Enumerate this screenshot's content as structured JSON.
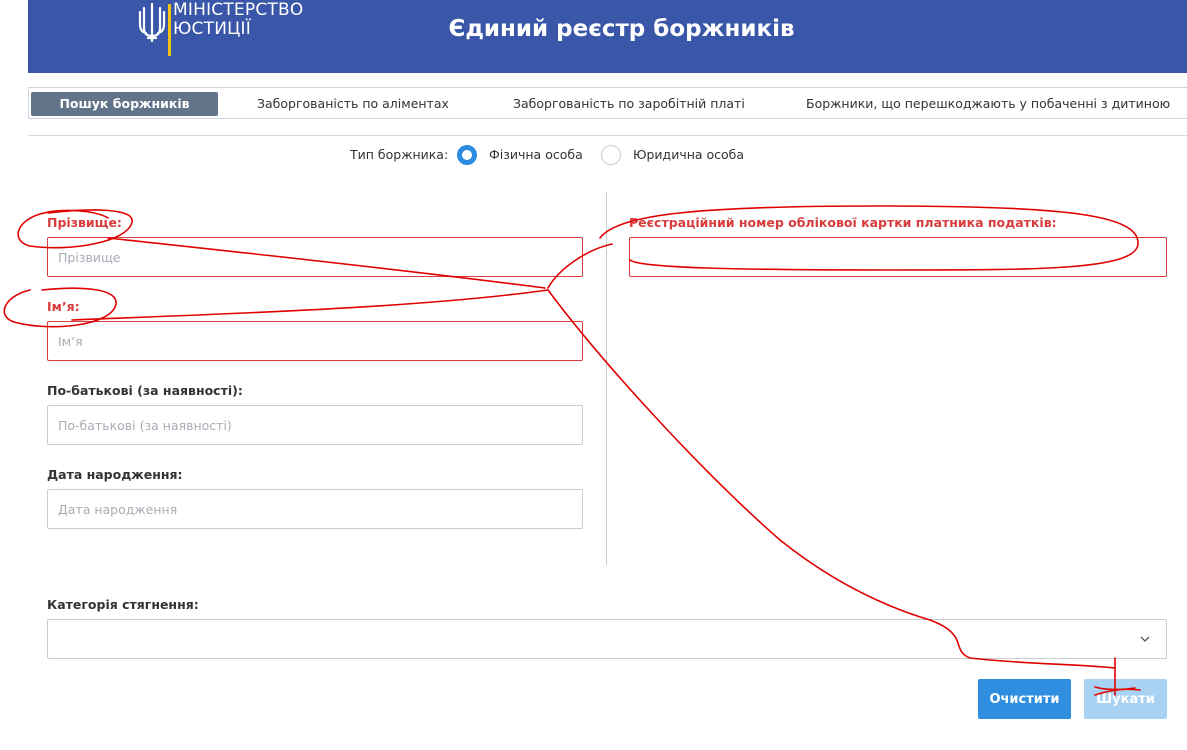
{
  "header": {
    "logo_line1": "МІНІСТЕРСТВО",
    "logo_line2": "ЮСТИЦІЇ",
    "title": "Єдиний реєстр боржників"
  },
  "tabs": [
    {
      "label": "Пошук боржників",
      "active": true
    },
    {
      "label": "Заборгованість по аліментах",
      "active": false
    },
    {
      "label": "Заборгованість по заробітній платі",
      "active": false
    },
    {
      "label": "Боржники, що перешкоджають у побаченні з дитиною",
      "active": false
    }
  ],
  "debtor_type": {
    "label": "Тип боржника:",
    "options": [
      {
        "label": "Фізична особа",
        "selected": true
      },
      {
        "label": "Юридична особа",
        "selected": false
      }
    ]
  },
  "form": {
    "surname": {
      "label": "Прізвище:",
      "placeholder": "Прізвище",
      "value": "",
      "error": true
    },
    "name": {
      "label": "Ім’я:",
      "placeholder": "Ім’я",
      "value": "",
      "error": true
    },
    "patronymic": {
      "label": "По-батькові (за наявності):",
      "placeholder": "По-батькові (за наявності)",
      "value": ""
    },
    "birth_date": {
      "label": "Дата народження:",
      "placeholder": "Дата народження",
      "value": ""
    },
    "tax_number": {
      "label": "Реєстраційний номер облікової картки платника податків:",
      "placeholder": "",
      "value": "",
      "error": true
    },
    "category": {
      "label": "Категорія стягнення:",
      "selected": ""
    }
  },
  "buttons": {
    "clear": "Очистити",
    "search": "Шукати"
  },
  "colors": {
    "header_bg": "#3a56a8",
    "active_tab": "#627489",
    "error": "#d93c3c",
    "primary_button": "#2f8ee0",
    "disabled_button": "#a9d1f2",
    "annotation_ink": "#e00000"
  }
}
